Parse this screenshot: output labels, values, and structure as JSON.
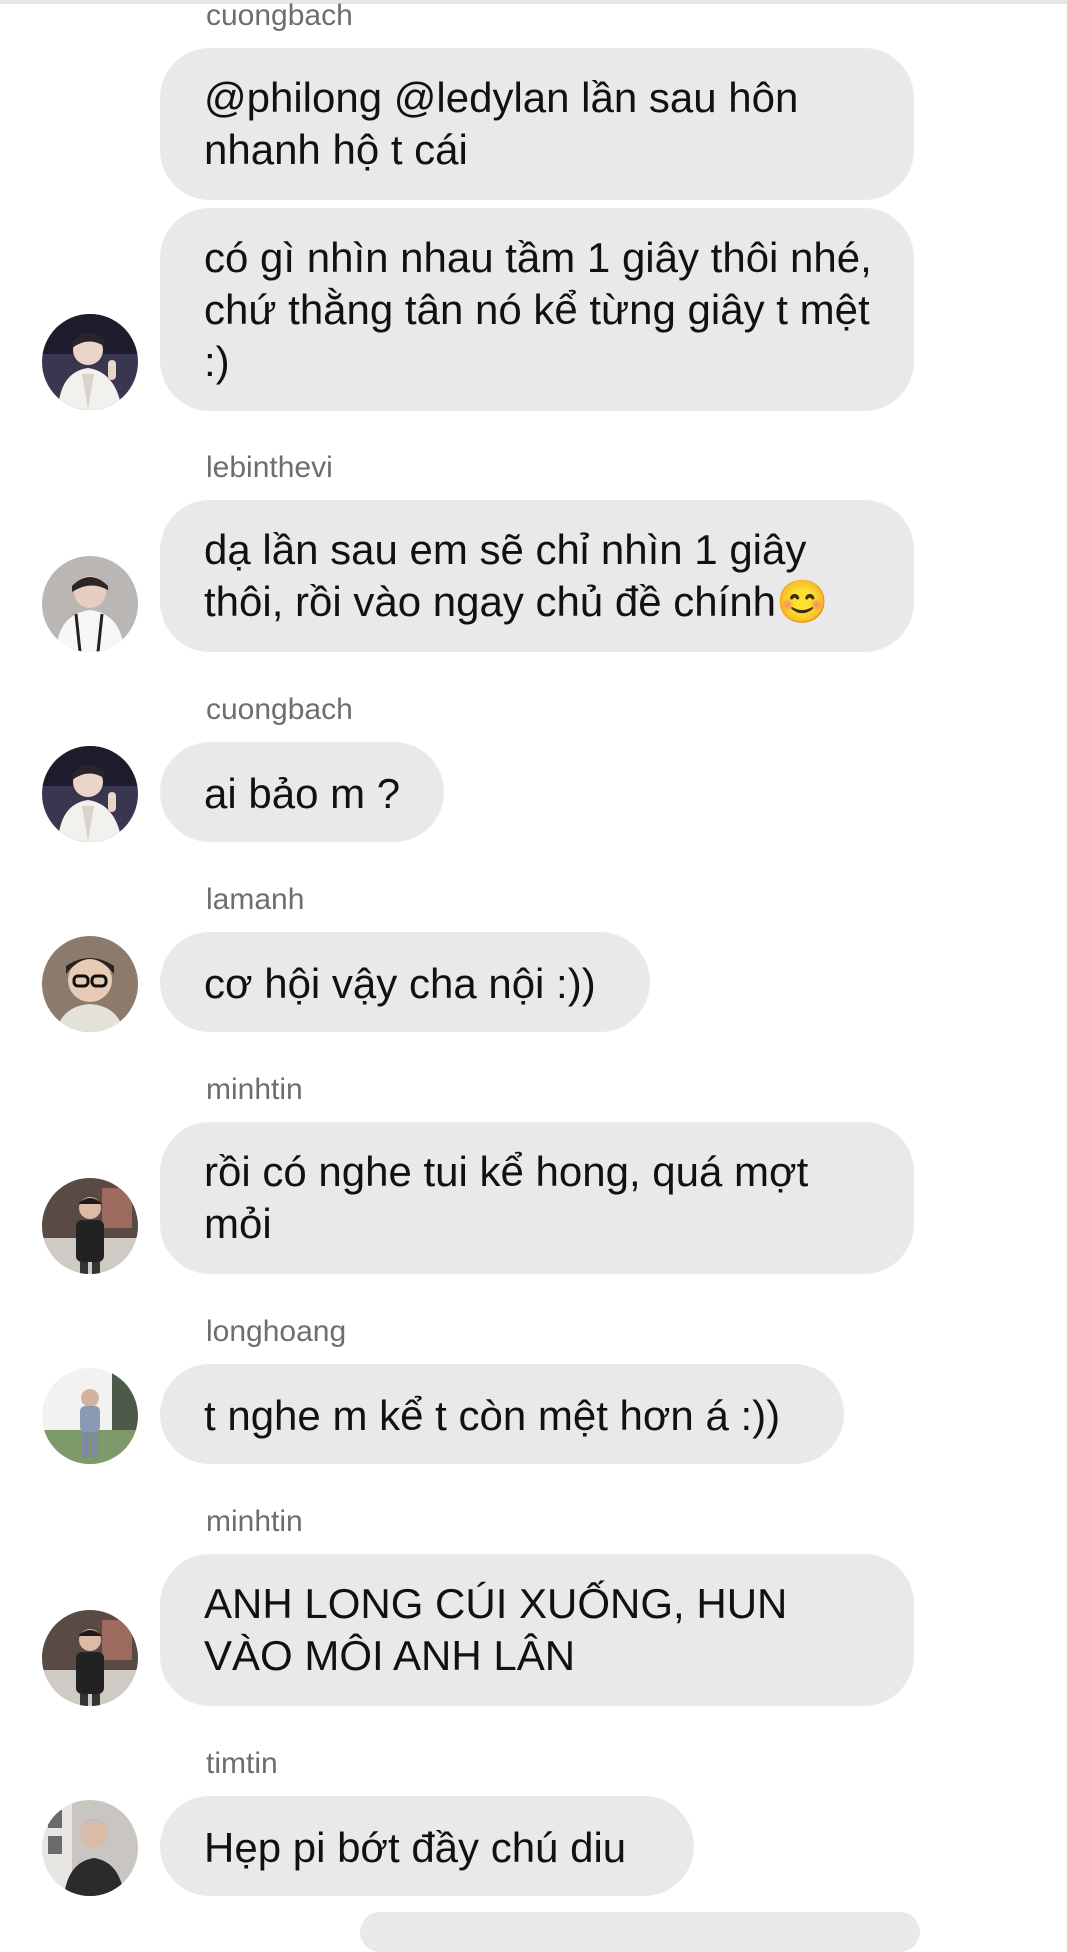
{
  "messages": [
    {
      "sender": "cuongbach",
      "bubbles": [
        "@philong @ledylan lần sau hôn nhanh hộ t cái",
        "có gì nhìn nhau tầm 1 giây thôi nhé, chứ thằng tân nó kể từng giây t mệt :)"
      ]
    },
    {
      "sender": "lebinthevi",
      "bubbles": [
        "dạ lần sau em sẽ chỉ nhìn 1 giây thôi, rồi vào ngay chủ đề chính😊"
      ]
    },
    {
      "sender": "cuongbach",
      "bubbles": [
        "ai bảo m ?"
      ]
    },
    {
      "sender": "lamanh",
      "bubbles": [
        "cơ hội vậy cha nội :))"
      ]
    },
    {
      "sender": "minhtin",
      "bubbles": [
        "rồi có nghe tui kể hong, quá mợt mỏi"
      ]
    },
    {
      "sender": "longhoang",
      "bubbles": [
        "t nghe m kể t còn mệt hơn á :))"
      ]
    },
    {
      "sender": "minhtin",
      "bubbles": [
        "ANH LONG CÚI XUỐNG, HUN VÀO MÔI ANH LÂN"
      ]
    },
    {
      "sender": "timtin",
      "bubbles": [
        "Hẹp pi bớt đầy chú diu"
      ]
    }
  ],
  "colors": {
    "bubble_bg": "#e9e9eb",
    "sender_text": "#6e6e6e",
    "message_text": "#111111",
    "background": "#ffffff"
  }
}
